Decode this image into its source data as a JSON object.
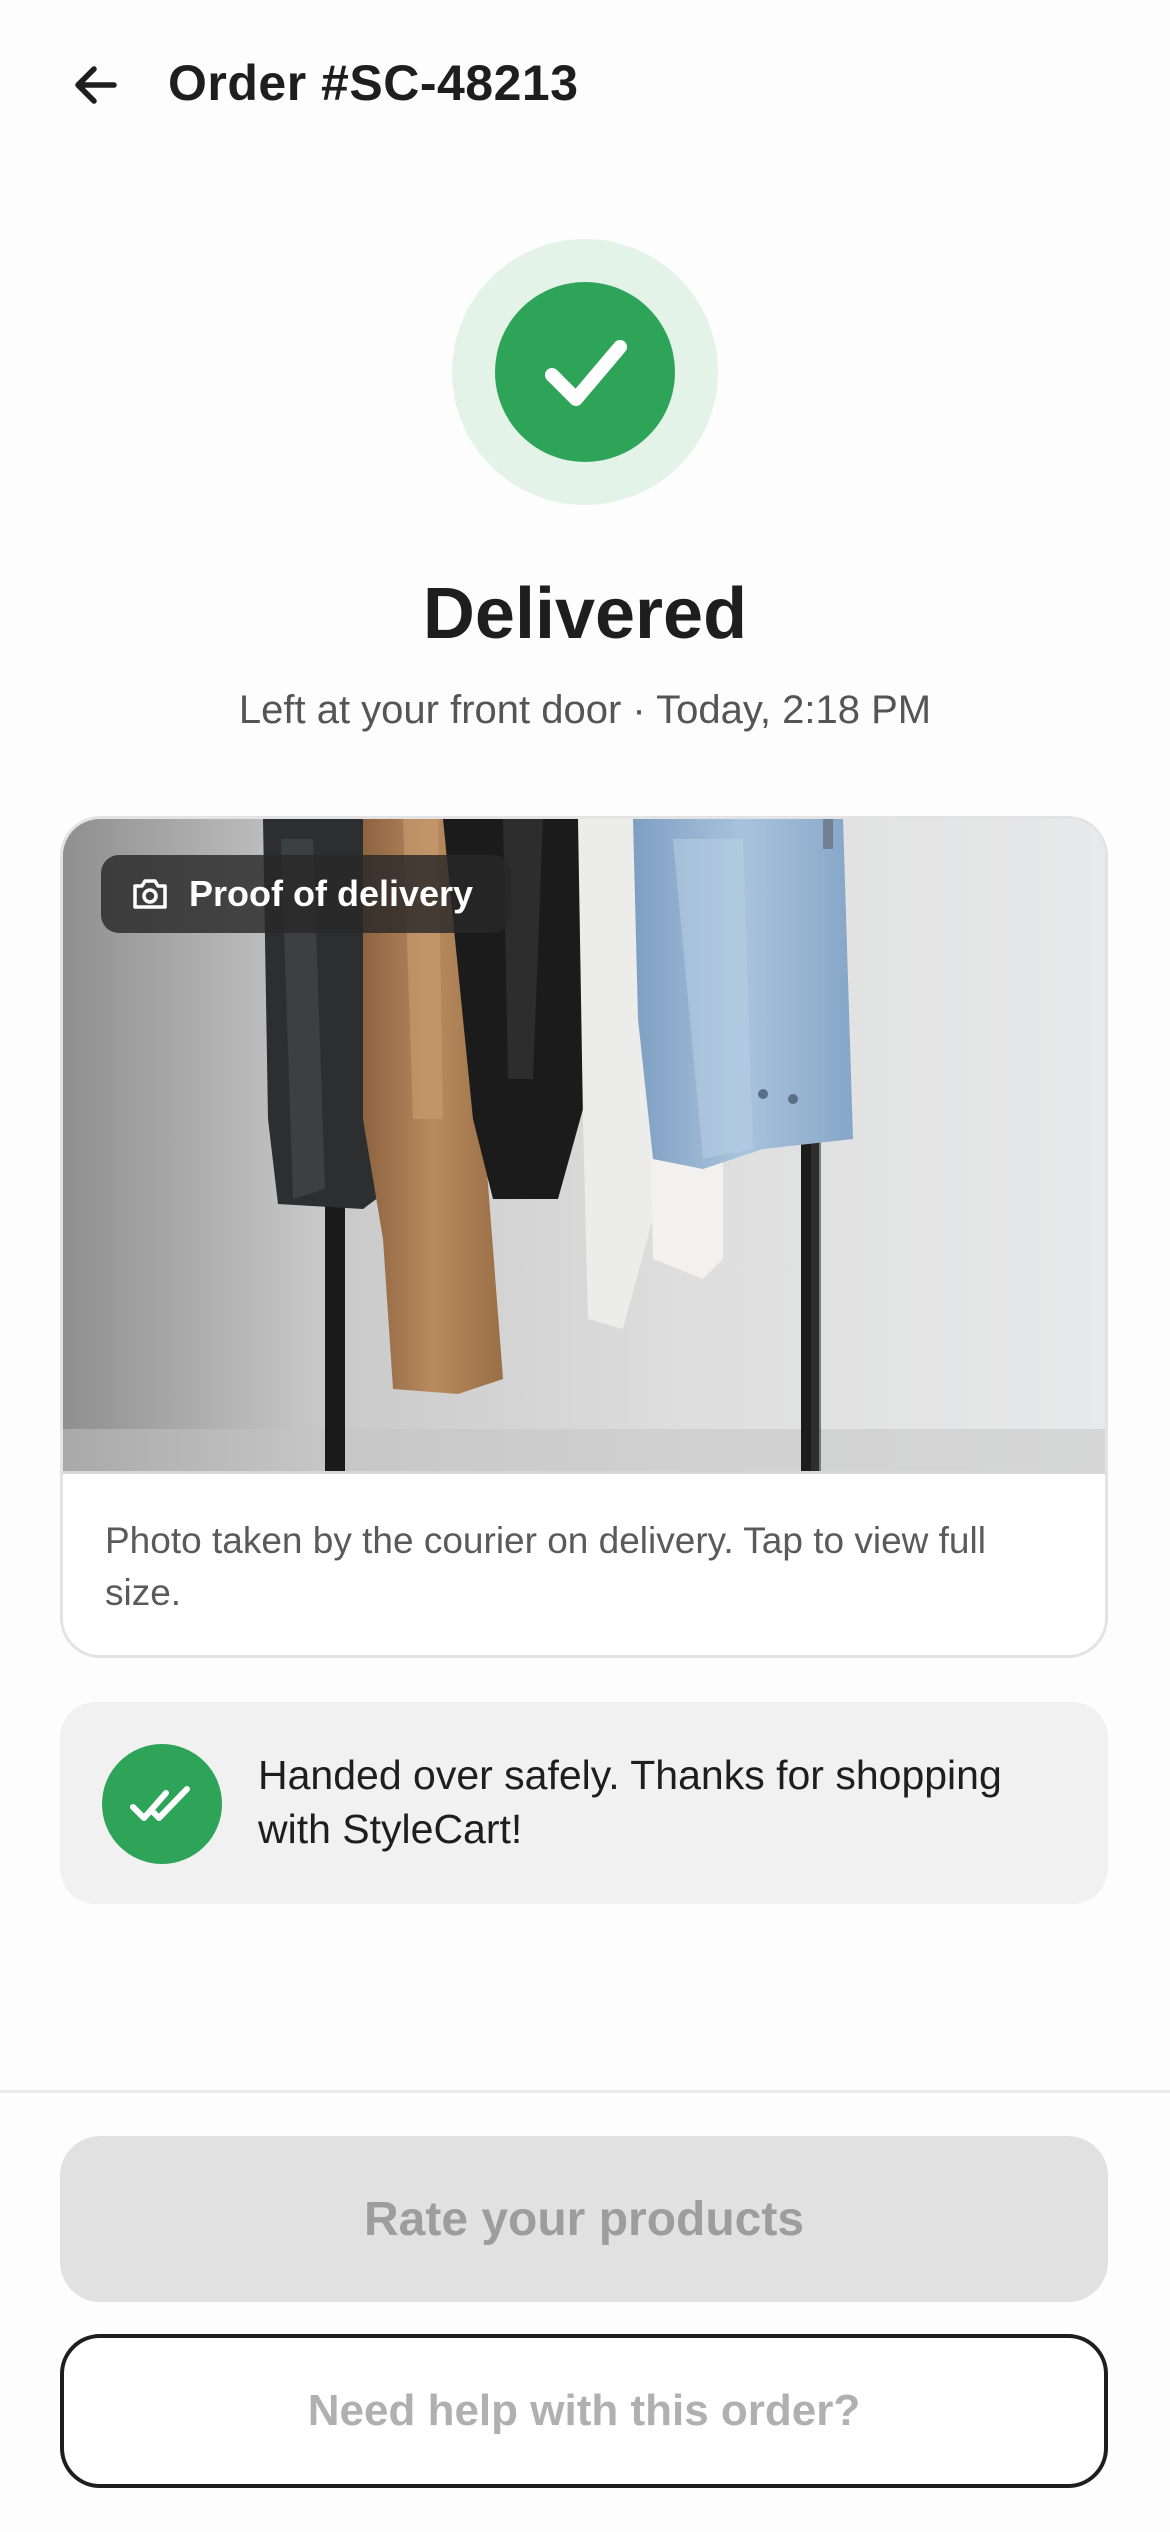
{
  "header": {
    "title": "Order #SC-48213",
    "back_icon": "arrow-left-icon"
  },
  "status": {
    "icon": "checkmark-icon",
    "title": "Delivered",
    "subtitle": "Left at your front door · Today, 2:18 PM"
  },
  "proof": {
    "badge_icon": "camera-icon",
    "badge_label": "Proof of delivery",
    "photo_subject": "clothes-rack-photo",
    "caption": "Photo taken by the courier on delivery. Tap to view full size."
  },
  "handed_over": {
    "icon": "double-check-icon",
    "message": "Handed over safely. Thanks for shopping with StyleCart!"
  },
  "actions": {
    "rate_label": "Rate your products",
    "help_label": "Need help with this order?"
  },
  "colors": {
    "success": "#2ea459",
    "success_light": "#e4f3e8",
    "text_primary": "#1e1e1e",
    "text_secondary": "#555555",
    "disabled_bg": "#e1e1e1",
    "disabled_text": "#9d9d9d"
  }
}
